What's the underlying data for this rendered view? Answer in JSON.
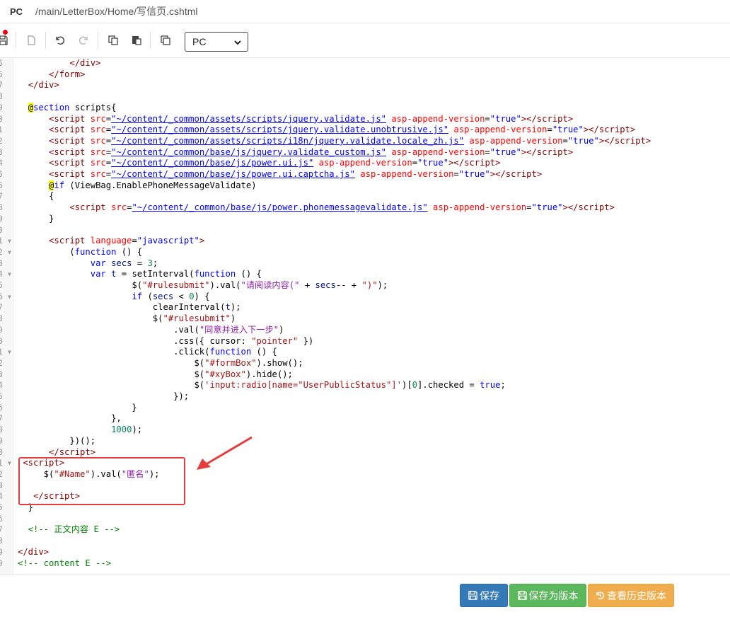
{
  "titlebar": {
    "mode": "PC",
    "path": "/main/LetterBox/Home/写信页.cshtml"
  },
  "toolbar": {
    "icons": [
      "save-icon",
      "new-file-icon",
      "undo-icon",
      "redo-icon",
      "copy-icon",
      "paste-icon",
      "duplicate-icon"
    ],
    "device_select": "PC"
  },
  "editor": {
    "lines": [
      {
        "n": "5",
        "fold": false,
        "html": "          <span class='t'>&lt;/div&gt;</span>"
      },
      {
        "n": "6",
        "fold": false,
        "html": "      <span class='t'>&lt;/form&gt;</span>"
      },
      {
        "n": "7",
        "fold": false,
        "html": "  <span class='t'>&lt;/div&gt;</span>"
      },
      {
        "n": "8",
        "fold": false,
        "html": ""
      },
      {
        "n": "9",
        "fold": false,
        "html": "  <span class='at'>@</span><span class='k'>section</span> scripts{"
      },
      {
        "n": "0",
        "fold": false,
        "html": "      <span class='t'>&lt;script</span> <span class='a'>src</span>=<span class='u'>\"~/content/_common/assets/scripts/jquery.validate.js\"</span> <span class='a'>asp-append-version</span>=<span class='s'>\"true\"</span><span class='t'>&gt;&lt;/script&gt;</span>"
      },
      {
        "n": "1",
        "fold": false,
        "html": "      <span class='t'>&lt;script</span> <span class='a'>src</span>=<span class='u'>\"~/content/_common/assets/scripts/jquery.validate.unobtrusive.js\"</span> <span class='a'>asp-append-version</span>=<span class='s'>\"true\"</span><span class='t'>&gt;&lt;/script&gt;</span>"
      },
      {
        "n": "2",
        "fold": false,
        "html": "      <span class='t'>&lt;script</span> <span class='a'>src</span>=<span class='u'>\"~/content/_common/assets/scripts/i18n/jquery.validate.locale_zh.js\"</span> <span class='a'>asp-append-version</span>=<span class='s'>\"true\"</span><span class='t'>&gt;&lt;/script&gt;</span>"
      },
      {
        "n": "3",
        "fold": false,
        "html": "      <span class='t'>&lt;script</span> <span class='a'>src</span>=<span class='u'>\"~/content/_common/base/js/jquery.validate_custom.js\"</span> <span class='a'>asp-append-version</span>=<span class='s'>\"true\"</span><span class='t'>&gt;&lt;/script&gt;</span>"
      },
      {
        "n": "4",
        "fold": false,
        "html": "      <span class='t'>&lt;script</span> <span class='a'>src</span>=<span class='u'>\"~/content/_common/base/js/power.ui.js\"</span> <span class='a'>asp-append-version</span>=<span class='s'>\"true\"</span><span class='t'>&gt;&lt;/script&gt;</span>"
      },
      {
        "n": "5",
        "fold": false,
        "html": "      <span class='t'>&lt;script</span> <span class='a'>src</span>=<span class='u'>\"~/content/_common/base/js/power.ui.captcha.js\"</span> <span class='a'>asp-append-version</span>=<span class='s'>\"true\"</span><span class='t'>&gt;&lt;/script&gt;</span>"
      },
      {
        "n": "6",
        "fold": false,
        "html": "      <span class='at'>@</span><span class='k'>if</span> (ViewBag.EnablePhoneMessageValidate)"
      },
      {
        "n": "7",
        "fold": false,
        "html": "      {"
      },
      {
        "n": "8",
        "fold": false,
        "html": "          <span class='t'>&lt;script</span> <span class='a'>src</span>=<span class='u'>\"~/content/_common/base/js/power.phonemessagevalidate.js\"</span> <span class='a'>asp-append-version</span>=<span class='s'>\"true\"</span><span class='t'>&gt;&lt;/script&gt;</span>"
      },
      {
        "n": "9",
        "fold": false,
        "html": "      }"
      },
      {
        "n": "0",
        "fold": false,
        "html": ""
      },
      {
        "n": "1",
        "fold": true,
        "html": "      <span class='t'>&lt;script</span> <span class='a'>language</span>=<span class='s'>\"javascript\"</span><span class='t'>&gt;</span>"
      },
      {
        "n": "2",
        "fold": true,
        "html": "          (<span class='k'>function</span> () {"
      },
      {
        "n": "3",
        "fold": false,
        "html": "              <span class='k'>var</span> <span class='v'>secs</span> = <span class='n'>3</span>;"
      },
      {
        "n": "4",
        "fold": true,
        "html": "              <span class='k'>var</span> <span class='v'>t</span> = setInterval(<span class='k'>function</span> () {"
      },
      {
        "n": "5",
        "fold": false,
        "html": "                      $(<span class='str'>\"#rulesubmit\"</span>).val(<span class='sp'>\"请阅读内容(\"</span> + <span class='v'>secs</span>-- + <span class='str'>\")\"</span>);"
      },
      {
        "n": "6",
        "fold": true,
        "html": "                      <span class='k'>if</span> (<span class='v'>secs</span> &lt; <span class='n'>0</span>) {"
      },
      {
        "n": "7",
        "fold": false,
        "html": "                          clearInterval(<span class='v'>t</span>);"
      },
      {
        "n": "8",
        "fold": false,
        "html": "                          $(<span class='str'>\"#rulesubmit\"</span>)"
      },
      {
        "n": "9",
        "fold": false,
        "html": "                              .val(<span class='sp'>\"同意并进入下一步\"</span>)"
      },
      {
        "n": "0",
        "fold": false,
        "html": "                              .css({ cursor: <span class='str'>\"pointer\"</span> })"
      },
      {
        "n": "1",
        "fold": true,
        "html": "                              .click(<span class='k'>function</span> () {"
      },
      {
        "n": "2",
        "fold": false,
        "html": "                                  $(<span class='str'>\"#formBox\"</span>).show();"
      },
      {
        "n": "3",
        "fold": false,
        "html": "                                  $(<span class='str'>\"#xyBox\"</span>).hide();"
      },
      {
        "n": "4",
        "fold": false,
        "html": "                                  $(<span class='str'>'input:radio[name=\"UserPublicStatus\"]'</span>)[<span class='n'>0</span>].checked = <span class='k'>true</span>;"
      },
      {
        "n": "5",
        "fold": false,
        "html": "                              });"
      },
      {
        "n": "6",
        "fold": false,
        "html": "                      }"
      },
      {
        "n": "7",
        "fold": false,
        "html": "                  },"
      },
      {
        "n": "8",
        "fold": false,
        "html": "                  <span class='n'>1000</span>);"
      },
      {
        "n": "9",
        "fold": false,
        "html": "          })();"
      },
      {
        "n": "0",
        "fold": false,
        "html": "      <span class='t'>&lt;/script&gt;</span>"
      },
      {
        "n": "1",
        "fold": true,
        "html": " <span class='t'>&lt;script&gt;</span>"
      },
      {
        "n": "2",
        "fold": false,
        "html": "     $(<span class='str'>\"#Name\"</span>).val(<span class='sp'>\"匿名\"</span>);"
      },
      {
        "n": "3",
        "fold": false,
        "html": ""
      },
      {
        "n": "4",
        "fold": false,
        "html": "   <span class='t'>&lt;/script&gt;</span>"
      },
      {
        "n": "5",
        "fold": false,
        "html": "  }"
      },
      {
        "n": "6",
        "fold": false,
        "html": ""
      },
      {
        "n": "7",
        "fold": false,
        "html": "  <span class='c'>&lt;!-- 正文内容 E --&gt;</span>"
      },
      {
        "n": "8",
        "fold": false,
        "html": ""
      },
      {
        "n": "9",
        "fold": false,
        "html": "<span class='t'>&lt;/div&gt;</span>"
      },
      {
        "n": "0",
        "fold": false,
        "html": "<span class='c'>&lt;!-- content E --&gt;</span>"
      }
    ]
  },
  "footer": {
    "save": "保存",
    "save_as_version": "保存为版本",
    "view_history": "查看历史版本"
  },
  "colors": {
    "primary": "#337ab7",
    "success": "#5cb85c",
    "warning": "#f0ad4e",
    "highlight": "#e33d3d"
  }
}
